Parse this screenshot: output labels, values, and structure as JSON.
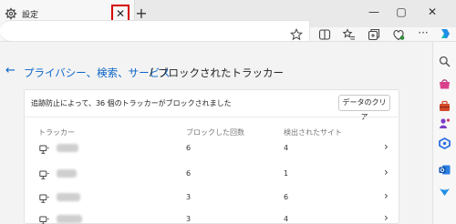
{
  "tab": {
    "title": "設定",
    "close_glyph": "✕",
    "icon": "gear-icon"
  },
  "new_tab_glyph": "+",
  "window_controls": {
    "minimize": "—",
    "maximize": "▢",
    "close": "✕"
  },
  "breadcrumb": {
    "back_glyph": "←",
    "parent": "プライバシー、検索、サービス",
    "separator": "/",
    "current": "ブロックされたトラッカー"
  },
  "summary_text": "追跡防止によって、36 個のトラッカーがブロックされました",
  "clear_button_label": "データのクリア",
  "columns": {
    "tracker": "トラッカー",
    "blocked_count": "ブロックした回数",
    "detected_sites": "検出されたサイト"
  },
  "rows": [
    {
      "blocked": "6",
      "detected": "4"
    },
    {
      "blocked": "6",
      "detected": "1"
    },
    {
      "blocked": "3",
      "detected": "6"
    },
    {
      "blocked": "3",
      "detected": "4"
    }
  ],
  "chevron_glyph": "›",
  "colors": {
    "accent": "#0a64c8",
    "highlight_box": "#d40000"
  }
}
